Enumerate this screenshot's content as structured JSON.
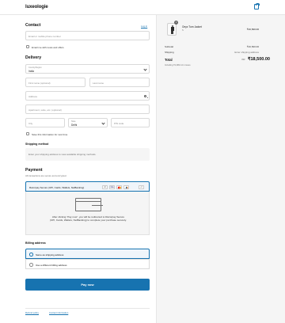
{
  "header": {
    "logo": "luxeologie"
  },
  "contact": {
    "title": "Contact",
    "login_link": "Log in",
    "email_placeholder": "Email or mobile phone number",
    "news_label": "Email me with news and offers"
  },
  "delivery": {
    "title": "Delivery",
    "country_label": "Country/Region",
    "country_value": "India",
    "first_name_placeholder": "First name (optional)",
    "last_name_placeholder": "Last name",
    "address_placeholder": "Address",
    "apartment_placeholder": "Apartment, suite, etc. (optional)",
    "city_placeholder": "City",
    "state_label": "State",
    "state_value": "Delhi",
    "pin_placeholder": "PIN code",
    "save_label": "Save this information for next time"
  },
  "shipping": {
    "title": "Shipping method",
    "message": "Enter your shipping address to view available shipping methods."
  },
  "payment": {
    "title": "Payment",
    "subtitle": "All transactions are secure and encrypted.",
    "option_label": "Razorpay Secure (UPI, Cards, Wallets, NetBanking)",
    "icons": [
      "UPI",
      "VISA",
      "MC",
      "RuPay",
      "+17"
    ],
    "more_label": "+17",
    "message": "After clicking “Pay now”, you will be redirected to Razorpay Secure (UPI, Cards, Wallets, NetBanking) to complete your purchase securely."
  },
  "billing": {
    "title": "Billing address",
    "same_label": "Same as shipping address",
    "different_label": "Use a different billing address"
  },
  "pay_button": "Pay now",
  "footer": {
    "refund": "Refund policy",
    "contact": "Contact information"
  },
  "summary": {
    "item_name": "Onyx Turn Jacket",
    "item_variant": "S",
    "item_price": "₹16,500.00",
    "qty": "1",
    "subtotal_label": "Subtotal",
    "subtotal_value": "₹16,500.00",
    "shipping_label": "Shipping",
    "shipping_value": "Enter shipping address",
    "total_label": "Total",
    "currency": "INR",
    "total_value": "₹18,500.00",
    "tax_note": "Including ₹1,982.14 in taxes"
  },
  "colors": {
    "accent": "#1773b0",
    "panel": "#f5f5f5"
  }
}
